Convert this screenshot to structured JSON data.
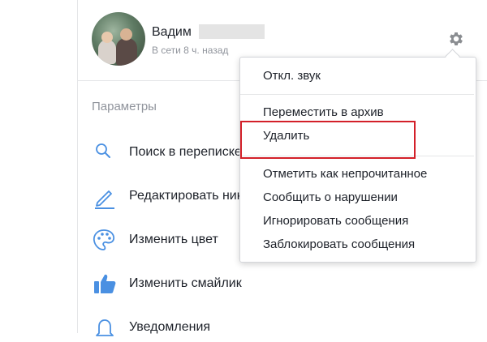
{
  "contact": {
    "name": "Вадим",
    "status": "В сети 8 ч. назад"
  },
  "settings": {
    "section_title": "Параметры",
    "items": [
      {
        "label": "Поиск в переписке",
        "icon": "search-icon"
      },
      {
        "label": "Редактировать ники",
        "icon": "pencil-icon"
      },
      {
        "label": "Изменить цвет",
        "icon": "palette-icon"
      },
      {
        "label": "Изменить смайлик",
        "icon": "thumbs-up-icon"
      },
      {
        "label": "Уведомления",
        "icon": "bell-icon"
      }
    ]
  },
  "dropdown": {
    "groups": [
      [
        "Откл. звук"
      ],
      [
        "Переместить в архив",
        "Удалить"
      ],
      [
        "Отметить как непрочитанное",
        "Сообщить о нарушении",
        "Игнорировать сообщения",
        "Заблокировать сообщения"
      ]
    ],
    "highlighted_item": "Удалить"
  },
  "colors": {
    "accent_blue": "#0084ff",
    "highlight_red": "#d32029",
    "muted_text": "#90949c"
  }
}
